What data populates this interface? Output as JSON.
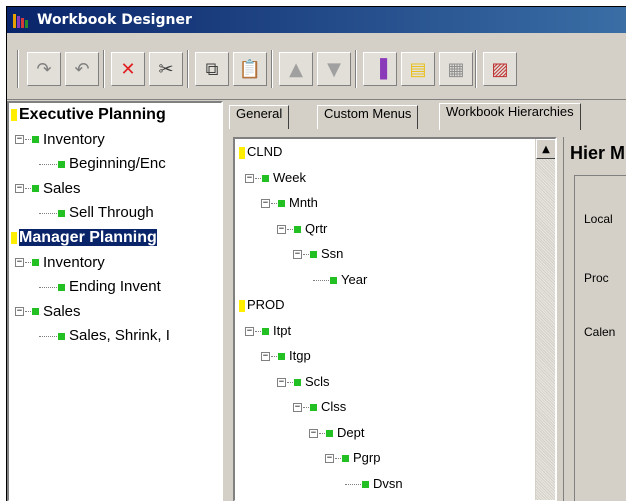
{
  "window": {
    "title": "Workbook Designer"
  },
  "toolbar": {
    "buttons": [
      {
        "name": "redo-icon",
        "glyph": "↷",
        "color": "#808080"
      },
      {
        "name": "undo-icon",
        "glyph": "↶",
        "color": "#808080"
      },
      {
        "name": "delete-icon",
        "glyph": "✕",
        "color": "#e02020"
      },
      {
        "name": "cut-icon",
        "glyph": "✂",
        "color": "#404040"
      },
      {
        "name": "copy-icon",
        "glyph": "⧉",
        "color": "#404040"
      },
      {
        "name": "paste-icon",
        "glyph": "📋",
        "color": "#404040"
      },
      {
        "name": "move-up-icon",
        "glyph": "▲",
        "color": "#a0a0a0"
      },
      {
        "name": "move-down-icon",
        "glyph": "▼",
        "color": "#a0a0a0"
      },
      {
        "name": "workbook-icon",
        "glyph": "▐",
        "color": "#8a3ab9"
      },
      {
        "name": "folder-icon",
        "glyph": "▤",
        "color": "#e8c020"
      },
      {
        "name": "grid-icon",
        "glyph": "▦",
        "color": "#909090"
      },
      {
        "name": "chart-icon",
        "glyph": "▨",
        "color": "#c03030"
      }
    ]
  },
  "left_tree": [
    {
      "label": "Executive Planning",
      "level": 0,
      "type": "root"
    },
    {
      "label": "Inventory",
      "level": 1,
      "type": "expand"
    },
    {
      "label": "Beginning/Enc",
      "level": 2,
      "type": "leaf"
    },
    {
      "label": "Sales",
      "level": 1,
      "type": "expand"
    },
    {
      "label": "Sell Through",
      "level": 2,
      "type": "leaf"
    },
    {
      "label": "Manager Planning",
      "level": 0,
      "type": "root",
      "selected": true
    },
    {
      "label": "Inventory",
      "level": 1,
      "type": "expand"
    },
    {
      "label": "Ending Invent",
      "level": 2,
      "type": "leaf"
    },
    {
      "label": "Sales",
      "level": 1,
      "type": "expand"
    },
    {
      "label": "Sales, Shrink, I",
      "level": 2,
      "type": "leaf"
    }
  ],
  "tabs": [
    "General",
    "Custom Menus",
    "Workbook Hierarchies"
  ],
  "active_tab": 2,
  "hierarchy_tree": [
    {
      "label": "CLND",
      "level": 0,
      "type": "root"
    },
    {
      "label": "Week",
      "level": 0,
      "type": "expand"
    },
    {
      "label": "Mnth",
      "level": 1,
      "type": "expand"
    },
    {
      "label": "Qrtr",
      "level": 2,
      "type": "expand"
    },
    {
      "label": "Ssn",
      "level": 3,
      "type": "expand"
    },
    {
      "label": "Year",
      "level": 4,
      "type": "leaf"
    },
    {
      "label": "PROD",
      "level": 0,
      "type": "root"
    },
    {
      "label": "Itpt",
      "level": 0,
      "type": "expand"
    },
    {
      "label": "Itgp",
      "level": 1,
      "type": "expand"
    },
    {
      "label": "Scls",
      "level": 2,
      "type": "expand"
    },
    {
      "label": "Clss",
      "level": 3,
      "type": "expand"
    },
    {
      "label": "Dept",
      "level": 4,
      "type": "expand"
    },
    {
      "label": "Pgrp",
      "level": 5,
      "type": "expand"
    },
    {
      "label": "Dvsn",
      "level": 6,
      "type": "leaf"
    }
  ],
  "right_panel": {
    "title": "Hier M",
    "labels": [
      "Local",
      "Proc",
      "Calen"
    ]
  }
}
